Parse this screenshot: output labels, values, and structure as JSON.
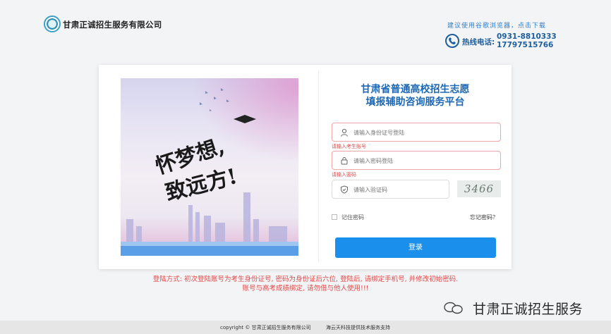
{
  "header": {
    "company_name": "甘肃正诚招生服务有限公司",
    "browser_tip": "建议使用谷歌浏览器，点击下载",
    "hotline_label": "热线电话:",
    "hotline_numbers": [
      "0931-8810333",
      "17797515766"
    ]
  },
  "banner": {
    "slogan_line1": "怀梦想,",
    "slogan_line2": "致远方!"
  },
  "login": {
    "title_line1": "甘肃省普通高校招生志愿",
    "title_line2": "填报辅助咨询服务平台",
    "id_placeholder": "请输入身份证号登陆",
    "id_error": "请输入考生账号",
    "password_placeholder": "请输入密码登陆",
    "password_error": "请输入密码",
    "captcha_placeholder": "请输入验证码",
    "captcha_image_text": "3466",
    "remember_label": "记住密码",
    "forgot_label": "忘记密码？",
    "login_button": "登录"
  },
  "notice": {
    "line1": "登陆方式: 初次登陆账号为考生身份证号, 密码为身份证后六位, 登陆后, 请绑定手机号, 并修改初始密码.",
    "line2": "账号与高考成绩绑定, 请勿借与他人使用!!!"
  },
  "watermark": "甘肃正诚招生服务",
  "footer": {
    "copyright": "copyright © 甘肃正诚招生服务有限公司",
    "support": "海云天科技提供技术服务支持"
  },
  "colors": {
    "brand_blue": "#1d68b4",
    "button_blue": "#1a8fec",
    "error_red": "#e24b4b"
  },
  "icons": [
    "logo",
    "phone-icon",
    "user-icon",
    "lock-icon",
    "shield-icon",
    "wechat-icon"
  ]
}
